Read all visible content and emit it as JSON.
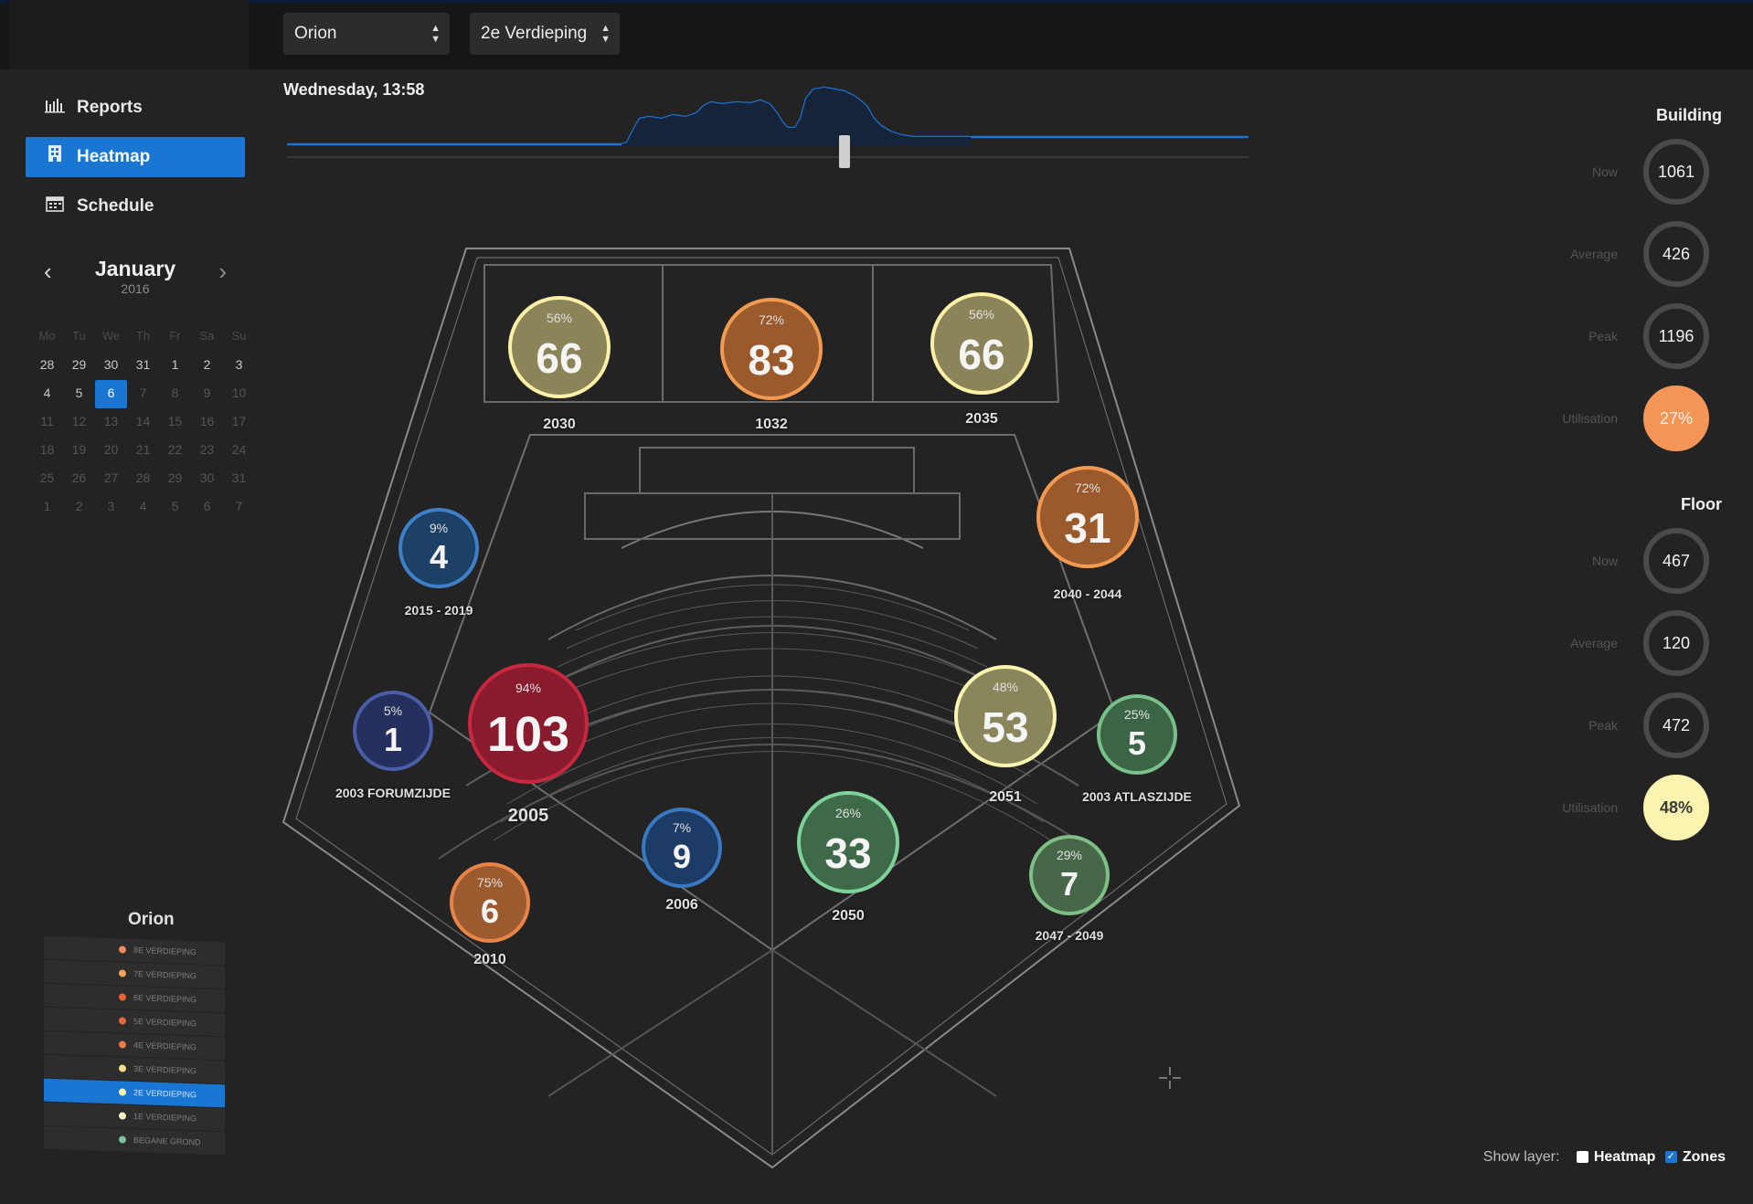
{
  "header": {
    "building_select": "Orion",
    "floor_select": "2e Verdieping"
  },
  "nav": [
    {
      "label": "Reports",
      "icon": "bar-chart-icon"
    },
    {
      "label": "Heatmap",
      "icon": "building-icon"
    },
    {
      "label": "Schedule",
      "icon": "calendar-icon"
    }
  ],
  "calendar": {
    "month": "January",
    "year": "2016",
    "dow": [
      "Mo",
      "Tu",
      "We",
      "Th",
      "Fr",
      "Sa",
      "Su"
    ],
    "weeks": [
      [
        "28",
        "29",
        "30",
        "31",
        "1",
        "2",
        "3"
      ],
      [
        "4",
        "5",
        "6",
        "7",
        "8",
        "9",
        "10"
      ],
      [
        "11",
        "12",
        "13",
        "14",
        "15",
        "16",
        "17"
      ],
      [
        "18",
        "19",
        "20",
        "21",
        "22",
        "23",
        "24"
      ],
      [
        "25",
        "26",
        "27",
        "28",
        "29",
        "30",
        "31"
      ],
      [
        "1",
        "2",
        "3",
        "4",
        "5",
        "6",
        "7"
      ]
    ],
    "selected_day": "6"
  },
  "building_panel": {
    "title": "Orion",
    "floors": [
      {
        "label": "8E VERDIEPING",
        "color": "#f08a5d"
      },
      {
        "label": "7E VERDIEPING",
        "color": "#f4a35c"
      },
      {
        "label": "6E VERDIEPING",
        "color": "#e8653a"
      },
      {
        "label": "5E VERDIEPING",
        "color": "#e8653a"
      },
      {
        "label": "4E VERDIEPING",
        "color": "#f0784a"
      },
      {
        "label": "3E VERDIEPING",
        "color": "#f6e08a"
      },
      {
        "label": "2E VERDIEPING",
        "color": "#fdf4b0"
      },
      {
        "label": "1E VERDIEPING",
        "color": "#f7f2c0"
      },
      {
        "label": "BEGANE GROND",
        "color": "#79c29a"
      }
    ],
    "active_floor": "2E VERDIEPING"
  },
  "timeline": {
    "label": "Wednesday, 13:58"
  },
  "zones": [
    {
      "pct": "56%",
      "count": "66",
      "name": "2030",
      "color": "#8c8459",
      "ring": "#fbf1a6"
    },
    {
      "pct": "72%",
      "count": "83",
      "name": "1032",
      "color": "#9a5a2c",
      "ring": "#f29a52"
    },
    {
      "pct": "56%",
      "count": "66",
      "name": "2035",
      "color": "#8c8459",
      "ring": "#fbf1a6"
    },
    {
      "pct": "72%",
      "count": "31",
      "name": "2040 - 2044",
      "color": "#9a5a2c",
      "ring": "#f29a52"
    },
    {
      "pct": "9%",
      "count": "4",
      "name": "2015 - 2019",
      "color": "#1d4066",
      "ring": "#3d80c7"
    },
    {
      "pct": "5%",
      "count": "1",
      "name": "2003 FORUMZIJDE",
      "color": "#252f5c",
      "ring": "#4a5ea8"
    },
    {
      "pct": "94%",
      "count": "103",
      "name": "2005",
      "color": "#8a1a2e",
      "ring": "#c6283f"
    },
    {
      "pct": "48%",
      "count": "53",
      "name": "2051",
      "color": "#8a865c",
      "ring": "#fbf3b0"
    },
    {
      "pct": "25%",
      "count": "5",
      "name": "2003 ATLASZIJDE",
      "color": "#3c6447",
      "ring": "#78c08c"
    },
    {
      "pct": "7%",
      "count": "9",
      "name": "2006",
      "color": "#1c3c66",
      "ring": "#3a78c2"
    },
    {
      "pct": "26%",
      "count": "33",
      "name": "2050",
      "color": "#3e6a4a",
      "ring": "#7fd19a"
    },
    {
      "pct": "29%",
      "count": "7",
      "name": "2047 - 2049",
      "color": "#476848",
      "ring": "#7fbf86"
    },
    {
      "pct": "75%",
      "count": "6",
      "name": "2010",
      "color": "#9c5a2f",
      "ring": "#e8834a"
    }
  ],
  "stats": {
    "building_title": "Building",
    "building": [
      {
        "label": "Now",
        "value": "1061"
      },
      {
        "label": "Average",
        "value": "426"
      },
      {
        "label": "Peak",
        "value": "1196"
      },
      {
        "label": "Utilisation",
        "value": "27%"
      }
    ],
    "floor_title": "Floor",
    "floor": [
      {
        "label": "Now",
        "value": "467"
      },
      {
        "label": "Average",
        "value": "120"
      },
      {
        "label": "Peak",
        "value": "472"
      },
      {
        "label": "Utilisation",
        "value": "48%"
      }
    ]
  },
  "layers": {
    "label": "Show layer:",
    "heatmap": "Heatmap",
    "heatmap_checked": false,
    "zones": "Zones",
    "zones_checked": true
  }
}
